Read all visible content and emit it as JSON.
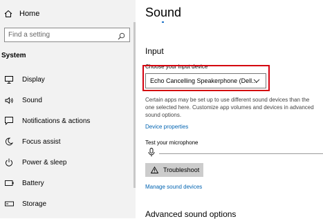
{
  "sidebar": {
    "home_label": "Home",
    "search_placeholder": "Find a setting",
    "section_label": "System",
    "items": [
      {
        "label": "Display",
        "icon": "monitor-icon"
      },
      {
        "label": "Sound",
        "icon": "speaker-icon"
      },
      {
        "label": "Notifications & actions",
        "icon": "notification-icon"
      },
      {
        "label": "Focus assist",
        "icon": "moon-icon"
      },
      {
        "label": "Power & sleep",
        "icon": "power-icon"
      },
      {
        "label": "Battery",
        "icon": "battery-icon"
      },
      {
        "label": "Storage",
        "icon": "storage-icon"
      }
    ]
  },
  "main": {
    "title": "Sound",
    "input": {
      "heading": "Input",
      "choose_label": "Choose your input device",
      "selected_device": "Echo Cancelling Speakerphone (Dell...",
      "description": "Certain apps may be set up to use different sound devices than the one selected here. Customize app volumes and devices in advanced sound options.",
      "device_properties_link": "Device properties",
      "test_label": "Test your microphone",
      "troubleshoot_label": "Troubleshoot",
      "manage_link": "Manage sound devices"
    },
    "advanced_heading": "Advanced sound options"
  },
  "colors": {
    "accent": "#0063b1",
    "highlight_box": "#d4000f",
    "sidebar_bg": "#f2f2f2"
  }
}
